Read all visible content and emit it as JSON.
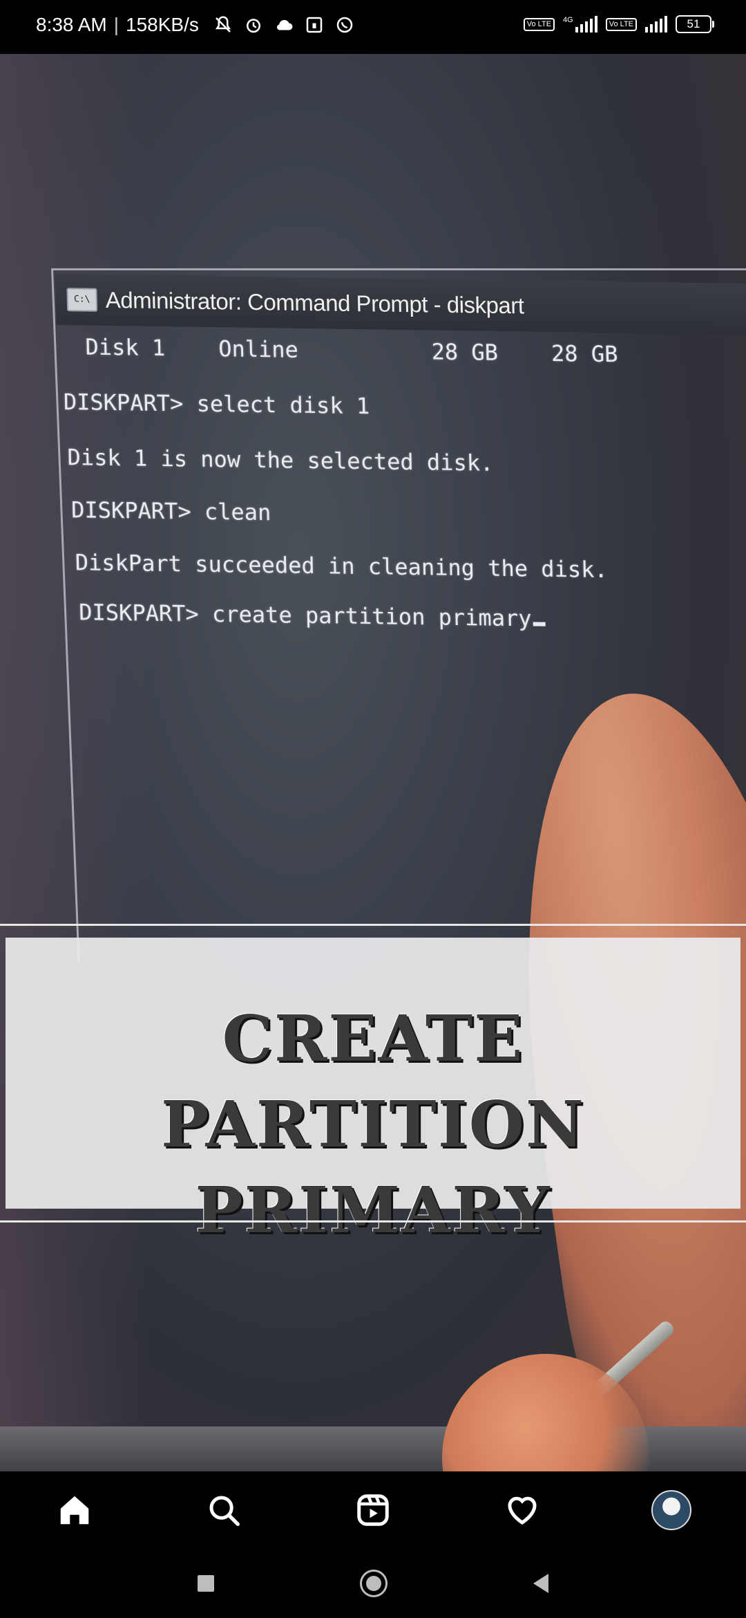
{
  "status_bar": {
    "time": "8:38 AM",
    "network_speed": "158KB/s",
    "volte_label": "Vo LTE",
    "network_type": "4G",
    "battery": "51"
  },
  "terminal": {
    "window_title": "Administrator: Command Prompt - diskpart",
    "icon_label": "C:\\",
    "lines": [
      " Disk 1    Online          28 GB    28 GB",
      "DISKPART> select disk 1",
      "Disk 1 is now the selected disk.",
      "DISKPART> clean",
      "DiskPart succeeded in cleaning the disk.",
      "DISKPART> create partition primary"
    ]
  },
  "caption": {
    "line1": "CREATE PARTITION",
    "line2": "PRIMARY"
  },
  "bottom_nav": {
    "items": [
      "home-icon",
      "search-icon",
      "reels-icon",
      "heart-icon",
      "profile-avatar"
    ]
  },
  "system_nav": [
    "recents-button",
    "home-button",
    "back-button"
  ]
}
